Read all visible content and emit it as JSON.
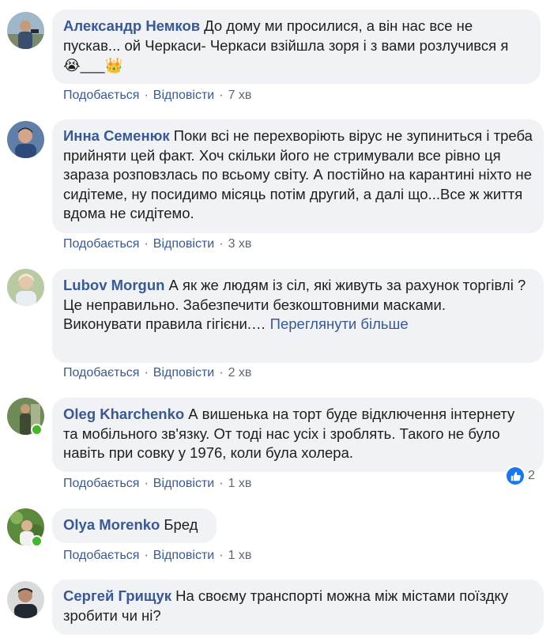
{
  "comments": [
    {
      "author": "Александр Немков",
      "text": "До дому ми просилися, а він нас все не пускав... ой Черкаси- Черкаси взійшла зоря і з вами розлучився я",
      "emoji_line": "😭___👑",
      "like_label": "Подобається",
      "reply_label": "Відповісти",
      "time": "7 хв",
      "online": false,
      "reactions": null
    },
    {
      "author": "Инна Семенюк",
      "text": "Поки всі не перехворіють вірус не зупиниться і треба прийняти цей факт. Хоч скільки його не стримували все рівно ця зараза розповзлась по всьому світу. А постійно на карантині ніхто не сидітеме, ну посидимо місяць потім другий, а далі що...Все ж життя вдома не сидітемо.",
      "like_label": "Подобається",
      "reply_label": "Відповісти",
      "time": "3 хв",
      "online": false,
      "reactions": null
    },
    {
      "author": "Lubov Morgun",
      "text_lines": [
        "А як же людям із сіл, які живуть за рахунок торгівлі ?",
        "Це неправильно. Забезпечити безкоштовними масками.",
        "Виконувати правила гігієни.…"
      ],
      "see_more": "Переглянути більше",
      "like_label": "Подобається",
      "reply_label": "Відповісти",
      "time": "2 хв",
      "online": false,
      "reactions": null
    },
    {
      "author": "Oleg Kharchenko",
      "text": "А вишенька на торт буде відключення інтернету та мобільного зв'язку. От тоді нас усіх і зроблять. Такого не було навіть при совку у 1976, коли була холера.",
      "like_label": "Подобається",
      "reply_label": "Відповісти",
      "time": "1 хв",
      "online": true,
      "reactions": "2"
    },
    {
      "author": "Olya Morenko",
      "text": "Бред",
      "like_label": "Подобається",
      "reply_label": "Відповісти",
      "time": "1 хв",
      "online": true,
      "reactions": null
    },
    {
      "author": "Сергей Грищук",
      "text": "На своєму транспорті можна між містами поїздку зробити чи ні?",
      "online": false,
      "reactions": null
    }
  ],
  "colors": {
    "link": "#385898",
    "bubble": "#f0f2f5",
    "meta": "#606770",
    "online": "#42b72a",
    "like": "#1877f2"
  }
}
